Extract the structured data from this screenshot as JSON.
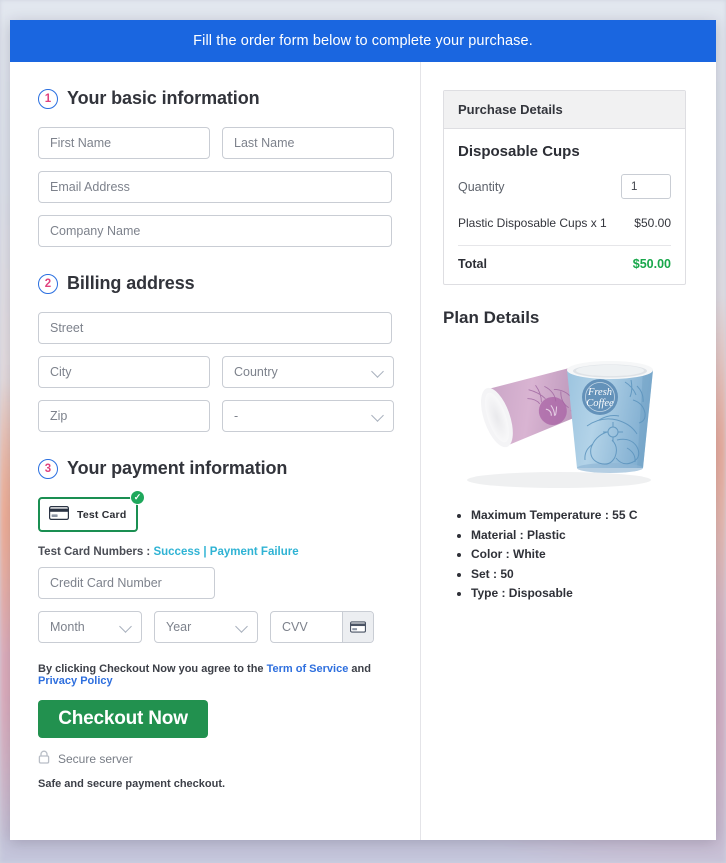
{
  "banner": {
    "text": "Fill the order form below to complete your purchase."
  },
  "steps": {
    "basic": {
      "num": "1",
      "title": "Your basic information"
    },
    "billing": {
      "num": "2",
      "title": "Billing address"
    },
    "payment": {
      "num": "3",
      "title": "Your payment information"
    }
  },
  "fields": {
    "first_name": "First Name",
    "last_name": "Last Name",
    "email": "Email Address",
    "company": "Company Name",
    "street": "Street",
    "city": "City",
    "country": "Country",
    "zip": "Zip",
    "state": "-",
    "card_number": "Credit Card Number",
    "month": "Month",
    "year": "Year",
    "cvv": "CVV"
  },
  "payment": {
    "method_label": "Test Card",
    "method_icon": "credit-card-icon",
    "selected_icon": "check-circle-icon",
    "test_cards_label": "Test Card Numbers :",
    "success_link": "Success",
    "separator": "|",
    "failure_link": "Payment Failure",
    "cvv_icon": "credit-card-icon"
  },
  "terms": {
    "prefix": "By clicking Checkout Now you agree to the",
    "tos_link": "Term of Service",
    "conjunction": "and",
    "privacy_link": "Privacy Policy"
  },
  "checkout": {
    "button_label": "Checkout Now",
    "secure_icon": "lock-icon",
    "secure_label": "Secure server",
    "safe_note": "Safe and secure payment checkout."
  },
  "purchase": {
    "panel_title": "Purchase Details",
    "product_name": "Disposable Cups",
    "quantity_label": "Quantity",
    "quantity_value": "1",
    "line_item": "Plastic Disposable Cups x 1",
    "line_amount": "$50.00",
    "total_label": "Total",
    "total_amount": "$50.00"
  },
  "plan": {
    "title": "Plan Details",
    "image_alt": "two-paper-coffee-cups-product-photo",
    "cup_brand_line1": "Fresh",
    "cup_brand_line2": "Coffee",
    "specs": [
      "Maximum Temperature : 55 C",
      "Material : Plastic",
      "Color : White",
      "Set : 50",
      "Type : Disposable"
    ]
  },
  "colors": {
    "banner_blue": "#1a66e0",
    "accent_green": "#22914f",
    "total_green": "#17a74a",
    "link_cyan": "#2fb3d4",
    "link_blue": "#2e6fde",
    "step_circle": "#2a6fe0",
    "step_number": "#e0427e"
  }
}
